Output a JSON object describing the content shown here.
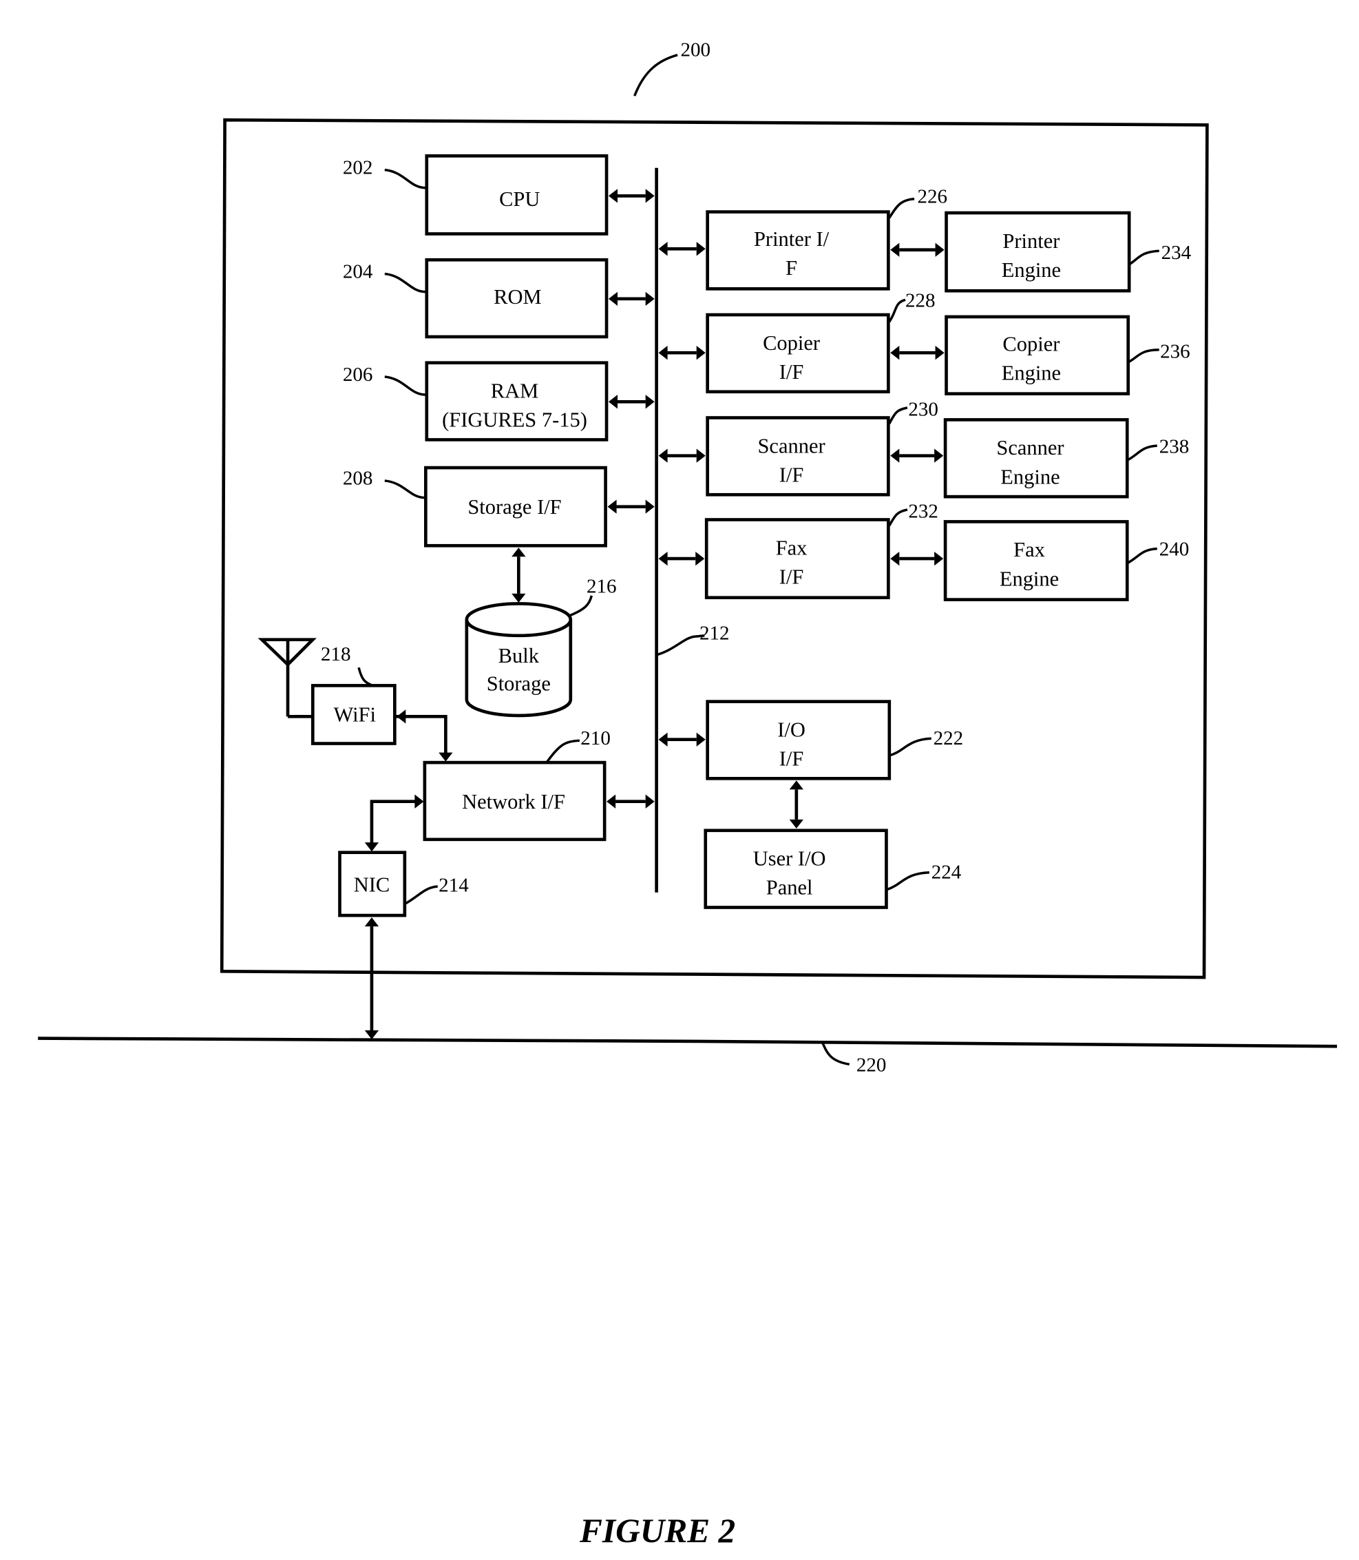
{
  "figure": {
    "caption": "FIGURE 2",
    "system_ref": "200",
    "bus_ref": "212",
    "network_ref": "220"
  },
  "left_components": [
    {
      "id": "cpu",
      "ref": "202",
      "lines": [
        "CPU"
      ]
    },
    {
      "id": "rom",
      "ref": "204",
      "lines": [
        "ROM"
      ]
    },
    {
      "id": "ram",
      "ref": "206",
      "lines": [
        "RAM",
        "(FIGURES 7-15)"
      ]
    },
    {
      "id": "storage-if",
      "ref": "208",
      "lines": [
        "Storage I/F"
      ]
    }
  ],
  "bulk_storage": {
    "ref": "216",
    "lines": [
      "Bulk",
      "Storage"
    ]
  },
  "wifi": {
    "ref": "218",
    "label": "WiFi"
  },
  "network_if": {
    "ref": "210",
    "label": "Network I/F"
  },
  "nic": {
    "ref": "214",
    "label": "NIC"
  },
  "interfaces": [
    {
      "id": "printer-if",
      "ref": "226",
      "lines": [
        "Printer I/",
        "F"
      ]
    },
    {
      "id": "copier-if",
      "ref": "228",
      "lines": [
        "Copier",
        "I/F"
      ]
    },
    {
      "id": "scanner-if",
      "ref": "230",
      "lines": [
        "Scanner",
        "I/F"
      ]
    },
    {
      "id": "fax-if",
      "ref": "232",
      "lines": [
        "Fax",
        "I/F"
      ]
    }
  ],
  "engines": [
    {
      "id": "printer-engine",
      "ref": "234",
      "lines": [
        "Printer",
        "Engine"
      ]
    },
    {
      "id": "copier-engine",
      "ref": "236",
      "lines": [
        "Copier",
        "Engine"
      ]
    },
    {
      "id": "scanner-engine",
      "ref": "238",
      "lines": [
        "Scanner",
        "Engine"
      ]
    },
    {
      "id": "fax-engine",
      "ref": "240",
      "lines": [
        "Fax",
        "Engine"
      ]
    }
  ],
  "io_if": {
    "ref": "222",
    "lines": [
      "I/O",
      "I/F"
    ]
  },
  "user_io_panel": {
    "ref": "224",
    "lines": [
      "User I/O",
      "Panel"
    ]
  }
}
